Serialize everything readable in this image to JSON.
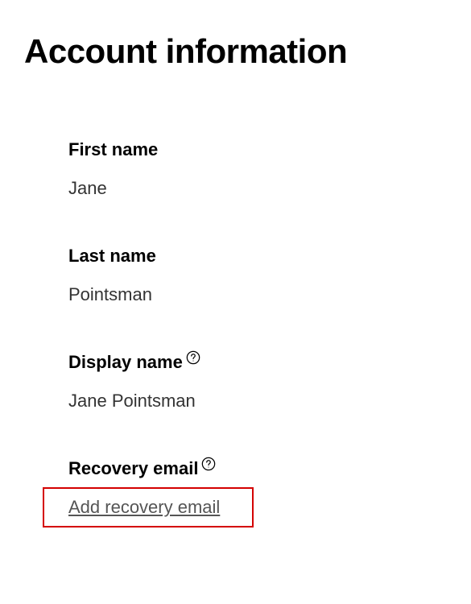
{
  "header": {
    "title": "Account information"
  },
  "fields": {
    "first_name": {
      "label": "First name",
      "value": "Jane"
    },
    "last_name": {
      "label": "Last name",
      "value": "Pointsman"
    },
    "display_name": {
      "label": "Display name",
      "value": "Jane Pointsman"
    },
    "recovery_email": {
      "label": "Recovery email",
      "action": "Add recovery email"
    }
  }
}
